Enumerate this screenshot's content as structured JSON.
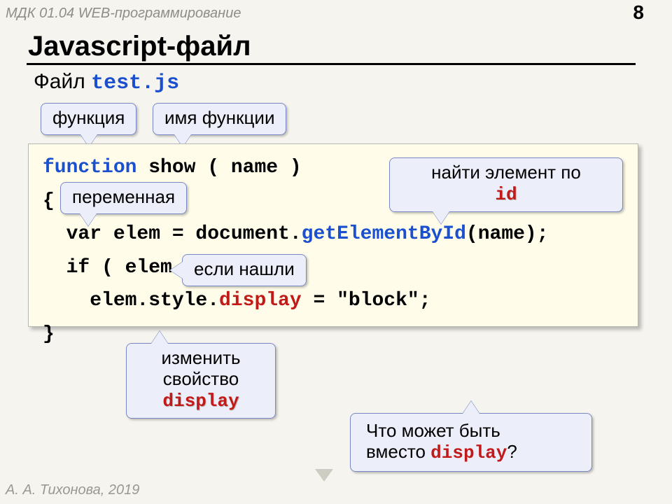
{
  "course": "МДК 01.04 WEB-программирование",
  "page": "8",
  "heading": "Javascript-файл",
  "subtitle_prefix": "Файл ",
  "subtitle_file": "test.js",
  "bubbles": {
    "func": "функция",
    "fname": "имя функции",
    "var": "переменная",
    "findById_line1": "найти элемент по",
    "findById_id": "id",
    "found": "если нашли",
    "changeProp_line1": "изменить",
    "changeProp_line2": "свойство",
    "changeProp_display": "display",
    "question_line1": "Что может быть",
    "question_line2a": "вместо ",
    "question_line2b": "display",
    "question_line2c": "?"
  },
  "code": {
    "l1a": "function",
    "l1b": " show ( name )",
    "l2": "{",
    "l3a": "  var elem = document.",
    "l3b": "getElementById",
    "l3c": "(name);",
    "l4": "  if ( elem )",
    "l5a": "    elem.style.",
    "l5b": "display",
    "l5c": " = \"block\";",
    "l6": "}"
  },
  "footer": "А. А. Тихонова, 2019"
}
